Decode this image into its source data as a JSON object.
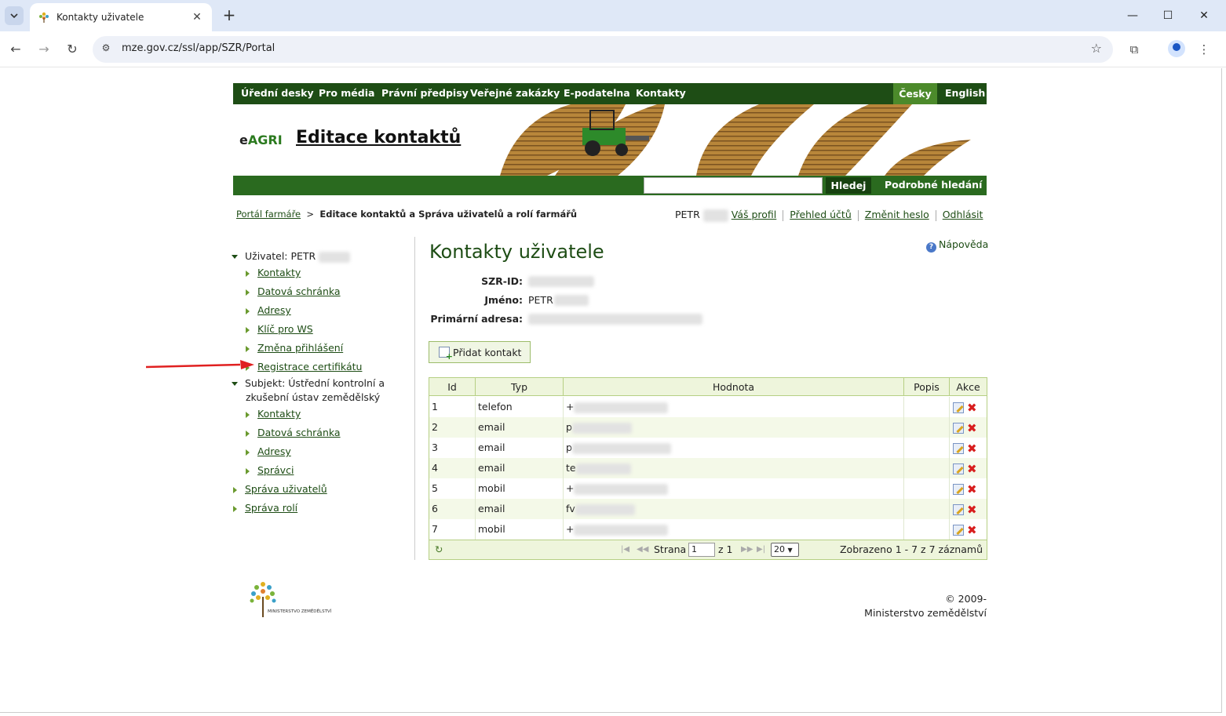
{
  "browser": {
    "tab_title": "Kontakty uživatele",
    "url": "mze.gov.cz/ssl/app/SZR/Portal"
  },
  "topnav": {
    "items": [
      "Úřední desky",
      "Pro média",
      "Právní předpisy",
      "Veřejné zakázky",
      "E-podatelna",
      "Kontakty"
    ],
    "lang_cz": "Česky",
    "lang_en": "English"
  },
  "banner": {
    "logo_prefix": "e",
    "logo_name": "AGRI",
    "title": "Editace kontaktů"
  },
  "search": {
    "button": "Hledej",
    "advanced": "Podrobné hledání"
  },
  "breadcrumb": {
    "home": "Portál farmáře",
    "current": "Editace kontaktů a Správa uživatelů a rolí farmářů"
  },
  "userbar": {
    "user_name": "PETR",
    "profile": "Váš profil",
    "accounts": "Přehled účtů",
    "change_password": "Změnit heslo",
    "logout": "Odhlásit"
  },
  "sidebar": {
    "user_label": "Uživatel: PETR",
    "user_items": [
      "Kontakty",
      "Datová schránka",
      "Adresy",
      "Klíč pro WS",
      "Změna přihlášení",
      "Registrace certifikátu"
    ],
    "subject_label_1": "Subjekt: Ústřední kontrolní a",
    "subject_label_2": "zkušební ústav zemědělský",
    "subject_items": [
      "Kontakty",
      "Datová schránka",
      "Adresy",
      "Správci"
    ],
    "bottom_items": [
      "Správa uživatelů",
      "Správa rolí"
    ]
  },
  "main": {
    "title": "Kontakty uživatele",
    "help": "Nápověda",
    "szr_label": "SZR-ID:",
    "name_label": "Jméno:",
    "name_value": "PETR",
    "address_label": "Primární adresa:",
    "add_button": "Přidat kontakt"
  },
  "grid": {
    "headers": [
      "Id",
      "Typ",
      "Hodnota",
      "Popis",
      "Akce"
    ],
    "rows": [
      {
        "id": "1",
        "type": "telefon",
        "value": "+"
      },
      {
        "id": "2",
        "type": "email",
        "value": "p"
      },
      {
        "id": "3",
        "type": "email",
        "value": "p"
      },
      {
        "id": "4",
        "type": "email",
        "value": "te"
      },
      {
        "id": "5",
        "type": "mobil",
        "value": "+"
      },
      {
        "id": "6",
        "type": "email",
        "value": "fv"
      },
      {
        "id": "7",
        "type": "mobil",
        "value": "+"
      }
    ],
    "page_label": "Strana",
    "page_value": "1",
    "page_of": "z 1",
    "page_size": "20",
    "summary": "Zobrazeno 1 - 7 z 7 záznamů"
  },
  "footer": {
    "logo_text": "MINISTERSTVO ZEMĚDĚLSTVÍ",
    "copyright": "© 2009-",
    "ministry": "Ministerstvo zemědělství"
  }
}
